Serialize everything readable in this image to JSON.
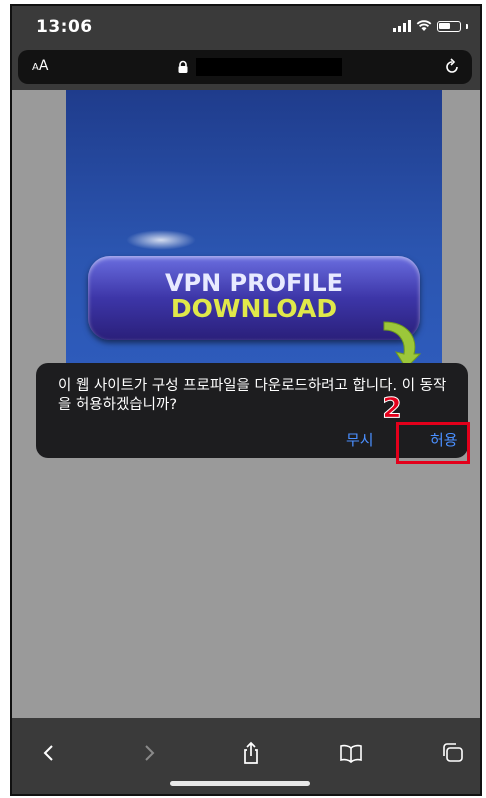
{
  "status_bar": {
    "time": "13:06"
  },
  "address_bar": {
    "text_size_label_small": "A",
    "text_size_label_large": "A"
  },
  "banner": {
    "line1": "VPN PROFILE",
    "line2": "DOWNLOAD"
  },
  "dialog": {
    "message": "이 웹 사이트가 구성 프로파일을 다운로드하려고 합니다. 이 동작을 허용하겠습니까?",
    "ignore_label": "무시",
    "allow_label": "허용"
  },
  "annotation": {
    "step_number": "2",
    "highlight_color": "#e3001b"
  },
  "toolbar": {
    "back": "chevron-left-icon",
    "forward": "chevron-right-icon",
    "share": "share-icon",
    "bookmarks": "book-icon",
    "tabs": "tabs-icon"
  },
  "colors": {
    "dialog_bg": "#1d1d1f",
    "link_blue": "#4a8fff",
    "chrome_bg": "#3a3a3a"
  }
}
